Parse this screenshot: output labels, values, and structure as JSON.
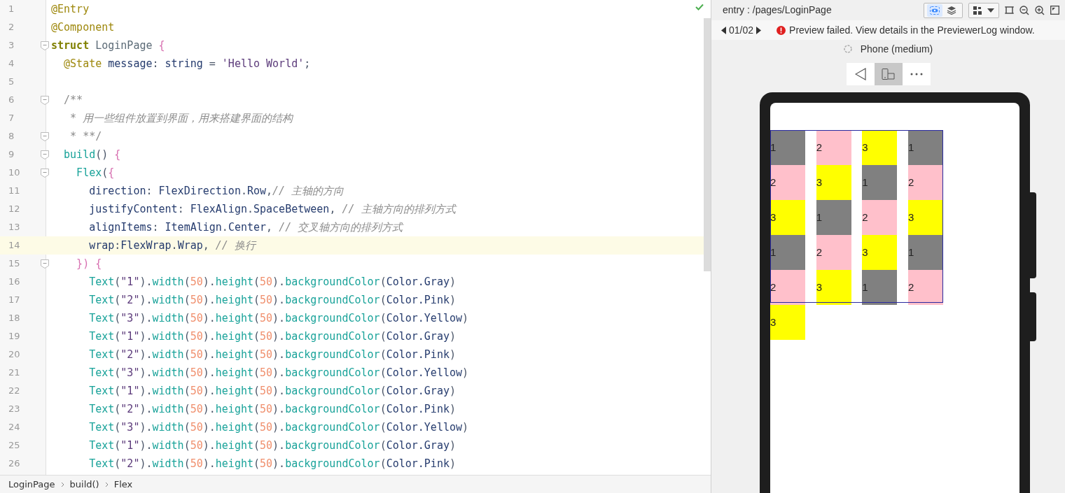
{
  "editor": {
    "lines": [
      {
        "number": "1",
        "fold": false,
        "current": false,
        "tokens": [
          {
            "kind": "ann",
            "text": "@Entry"
          }
        ]
      },
      {
        "number": "2",
        "fold": false,
        "current": false,
        "tokens": [
          {
            "kind": "ann",
            "text": "@Component"
          }
        ]
      },
      {
        "number": "3",
        "fold": true,
        "current": false,
        "tokens": [
          {
            "kind": "kw",
            "text": "struct "
          },
          {
            "kind": "cls",
            "text": "LoginPage "
          },
          {
            "kind": "br",
            "text": "{"
          }
        ]
      },
      {
        "number": "4",
        "fold": false,
        "current": false,
        "tokens": [
          {
            "kind": "ann",
            "text": "  @State "
          },
          {
            "kind": "id",
            "text": "message"
          },
          {
            "kind": "p",
            "text": ": "
          },
          {
            "kind": "id",
            "text": "string "
          },
          {
            "kind": "p",
            "text": "= "
          },
          {
            "kind": "s",
            "text": "'Hello World'"
          },
          {
            "kind": "p",
            "text": ";"
          }
        ]
      },
      {
        "number": "5",
        "fold": false,
        "current": false
      },
      {
        "number": "6",
        "fold": true,
        "current": false,
        "tokens": [
          {
            "kind": "doc",
            "text": "  /**"
          }
        ]
      },
      {
        "number": "7",
        "fold": false,
        "current": false,
        "tokens": [
          {
            "kind": "doc",
            "text": "   * "
          },
          {
            "kind": "cmt",
            "text": "用一些组件放置到界面，用来搭建界面的结构"
          }
        ]
      },
      {
        "number": "8",
        "fold": true,
        "current": false,
        "tokens": [
          {
            "kind": "doc",
            "text": "   * **/"
          }
        ]
      },
      {
        "number": "9",
        "fold": true,
        "current": false,
        "tokens": [
          {
            "kind": "fn",
            "text": "  build"
          },
          {
            "kind": "p",
            "text": "() "
          },
          {
            "kind": "br",
            "text": "{"
          }
        ]
      },
      {
        "number": "10",
        "fold": true,
        "current": false,
        "tokens": [
          {
            "kind": "fn",
            "text": "    Flex"
          },
          {
            "kind": "p",
            "text": "("
          },
          {
            "kind": "br",
            "text": "{"
          }
        ]
      },
      {
        "number": "11",
        "fold": false,
        "current": false,
        "tokens": [
          {
            "kind": "id",
            "text": "      direction"
          },
          {
            "kind": "p",
            "text": ": "
          },
          {
            "kind": "id",
            "text": "FlexDirection"
          },
          {
            "kind": "p",
            "text": "."
          },
          {
            "kind": "id",
            "text": "Row"
          },
          {
            "kind": "p",
            "text": ","
          },
          {
            "kind": "cmt",
            "text": "// 主轴的方向"
          }
        ]
      },
      {
        "number": "12",
        "fold": false,
        "current": false,
        "tokens": [
          {
            "kind": "id",
            "text": "      justifyContent"
          },
          {
            "kind": "p",
            "text": ": "
          },
          {
            "kind": "id",
            "text": "FlexAlign"
          },
          {
            "kind": "p",
            "text": "."
          },
          {
            "kind": "id",
            "text": "SpaceBetween"
          },
          {
            "kind": "p",
            "text": ", "
          },
          {
            "kind": "cmt",
            "text": "// 主轴方向的排列方式"
          }
        ]
      },
      {
        "number": "13",
        "fold": false,
        "current": false,
        "tokens": [
          {
            "kind": "id",
            "text": "      alignItems"
          },
          {
            "kind": "p",
            "text": ": "
          },
          {
            "kind": "id",
            "text": "ItemAlign"
          },
          {
            "kind": "p",
            "text": "."
          },
          {
            "kind": "id",
            "text": "Center"
          },
          {
            "kind": "p",
            "text": ", "
          },
          {
            "kind": "cmt",
            "text": "// 交叉轴方向的排列方式"
          }
        ]
      },
      {
        "number": "14",
        "fold": false,
        "current": true,
        "tokens": [
          {
            "kind": "id",
            "text": "      wrap"
          },
          {
            "kind": "p",
            "text": ":"
          },
          {
            "kind": "id",
            "text": "FlexWrap"
          },
          {
            "kind": "p",
            "text": "."
          },
          {
            "kind": "id",
            "text": "Wrap"
          },
          {
            "kind": "p",
            "text": ", "
          },
          {
            "kind": "cmt",
            "text": "// 换行"
          }
        ]
      },
      {
        "number": "15",
        "fold": true,
        "current": false,
        "tokens": [
          {
            "kind": "br",
            "text": "    }) {"
          }
        ]
      },
      {
        "number": "16",
        "fold": false,
        "current": false,
        "tokens": [
          {
            "kind": "fn",
            "text": "      Text"
          },
          {
            "kind": "p",
            "text": "("
          },
          {
            "kind": "s",
            "text": "\"1\""
          },
          {
            "kind": "p",
            "text": ")."
          },
          {
            "kind": "fn",
            "text": "width"
          },
          {
            "kind": "p",
            "text": "("
          },
          {
            "kind": "n",
            "text": "50"
          },
          {
            "kind": "p",
            "text": ")."
          },
          {
            "kind": "fn",
            "text": "height"
          },
          {
            "kind": "p",
            "text": "("
          },
          {
            "kind": "n",
            "text": "50"
          },
          {
            "kind": "p",
            "text": ")."
          },
          {
            "kind": "fn",
            "text": "backgroundColor"
          },
          {
            "kind": "p",
            "text": "("
          },
          {
            "kind": "id",
            "text": "Color.Gray"
          },
          {
            "kind": "p",
            "text": ")"
          }
        ]
      },
      {
        "number": "17",
        "fold": false,
        "current": false,
        "tokens": [
          {
            "kind": "fn",
            "text": "      Text"
          },
          {
            "kind": "p",
            "text": "("
          },
          {
            "kind": "s",
            "text": "\"2\""
          },
          {
            "kind": "p",
            "text": ")."
          },
          {
            "kind": "fn",
            "text": "width"
          },
          {
            "kind": "p",
            "text": "("
          },
          {
            "kind": "n",
            "text": "50"
          },
          {
            "kind": "p",
            "text": ")."
          },
          {
            "kind": "fn",
            "text": "height"
          },
          {
            "kind": "p",
            "text": "("
          },
          {
            "kind": "n",
            "text": "50"
          },
          {
            "kind": "p",
            "text": ")."
          },
          {
            "kind": "fn",
            "text": "backgroundColor"
          },
          {
            "kind": "p",
            "text": "("
          },
          {
            "kind": "id",
            "text": "Color.Pink"
          },
          {
            "kind": "p",
            "text": ")"
          }
        ]
      },
      {
        "number": "18",
        "fold": false,
        "current": false,
        "tokens": [
          {
            "kind": "fn",
            "text": "      Text"
          },
          {
            "kind": "p",
            "text": "("
          },
          {
            "kind": "s",
            "text": "\"3\""
          },
          {
            "kind": "p",
            "text": ")."
          },
          {
            "kind": "fn",
            "text": "width"
          },
          {
            "kind": "p",
            "text": "("
          },
          {
            "kind": "n",
            "text": "50"
          },
          {
            "kind": "p",
            "text": ")."
          },
          {
            "kind": "fn",
            "text": "height"
          },
          {
            "kind": "p",
            "text": "("
          },
          {
            "kind": "n",
            "text": "50"
          },
          {
            "kind": "p",
            "text": ")."
          },
          {
            "kind": "fn",
            "text": "backgroundColor"
          },
          {
            "kind": "p",
            "text": "("
          },
          {
            "kind": "id",
            "text": "Color.Yellow"
          },
          {
            "kind": "p",
            "text": ")"
          }
        ]
      },
      {
        "number": "19",
        "fold": false,
        "current": false,
        "tokens": [
          {
            "kind": "fn",
            "text": "      Text"
          },
          {
            "kind": "p",
            "text": "("
          },
          {
            "kind": "s",
            "text": "\"1\""
          },
          {
            "kind": "p",
            "text": ")."
          },
          {
            "kind": "fn",
            "text": "width"
          },
          {
            "kind": "p",
            "text": "("
          },
          {
            "kind": "n",
            "text": "50"
          },
          {
            "kind": "p",
            "text": ")."
          },
          {
            "kind": "fn",
            "text": "height"
          },
          {
            "kind": "p",
            "text": "("
          },
          {
            "kind": "n",
            "text": "50"
          },
          {
            "kind": "p",
            "text": ")."
          },
          {
            "kind": "fn",
            "text": "backgroundColor"
          },
          {
            "kind": "p",
            "text": "("
          },
          {
            "kind": "id",
            "text": "Color.Gray"
          },
          {
            "kind": "p",
            "text": ")"
          }
        ]
      },
      {
        "number": "20",
        "fold": false,
        "current": false,
        "tokens": [
          {
            "kind": "fn",
            "text": "      Text"
          },
          {
            "kind": "p",
            "text": "("
          },
          {
            "kind": "s",
            "text": "\"2\""
          },
          {
            "kind": "p",
            "text": ")."
          },
          {
            "kind": "fn",
            "text": "width"
          },
          {
            "kind": "p",
            "text": "("
          },
          {
            "kind": "n",
            "text": "50"
          },
          {
            "kind": "p",
            "text": ")."
          },
          {
            "kind": "fn",
            "text": "height"
          },
          {
            "kind": "p",
            "text": "("
          },
          {
            "kind": "n",
            "text": "50"
          },
          {
            "kind": "p",
            "text": ")."
          },
          {
            "kind": "fn",
            "text": "backgroundColor"
          },
          {
            "kind": "p",
            "text": "("
          },
          {
            "kind": "id",
            "text": "Color.Pink"
          },
          {
            "kind": "p",
            "text": ")"
          }
        ]
      },
      {
        "number": "21",
        "fold": false,
        "current": false,
        "tokens": [
          {
            "kind": "fn",
            "text": "      Text"
          },
          {
            "kind": "p",
            "text": "("
          },
          {
            "kind": "s",
            "text": "\"3\""
          },
          {
            "kind": "p",
            "text": ")."
          },
          {
            "kind": "fn",
            "text": "width"
          },
          {
            "kind": "p",
            "text": "("
          },
          {
            "kind": "n",
            "text": "50"
          },
          {
            "kind": "p",
            "text": ")."
          },
          {
            "kind": "fn",
            "text": "height"
          },
          {
            "kind": "p",
            "text": "("
          },
          {
            "kind": "n",
            "text": "50"
          },
          {
            "kind": "p",
            "text": ")."
          },
          {
            "kind": "fn",
            "text": "backgroundColor"
          },
          {
            "kind": "p",
            "text": "("
          },
          {
            "kind": "id",
            "text": "Color.Yellow"
          },
          {
            "kind": "p",
            "text": ")"
          }
        ]
      },
      {
        "number": "22",
        "fold": false,
        "current": false,
        "tokens": [
          {
            "kind": "fn",
            "text": "      Text"
          },
          {
            "kind": "p",
            "text": "("
          },
          {
            "kind": "s",
            "text": "\"1\""
          },
          {
            "kind": "p",
            "text": ")."
          },
          {
            "kind": "fn",
            "text": "width"
          },
          {
            "kind": "p",
            "text": "("
          },
          {
            "kind": "n",
            "text": "50"
          },
          {
            "kind": "p",
            "text": ")."
          },
          {
            "kind": "fn",
            "text": "height"
          },
          {
            "kind": "p",
            "text": "("
          },
          {
            "kind": "n",
            "text": "50"
          },
          {
            "kind": "p",
            "text": ")."
          },
          {
            "kind": "fn",
            "text": "backgroundColor"
          },
          {
            "kind": "p",
            "text": "("
          },
          {
            "kind": "id",
            "text": "Color.Gray"
          },
          {
            "kind": "p",
            "text": ")"
          }
        ]
      },
      {
        "number": "23",
        "fold": false,
        "current": false,
        "tokens": [
          {
            "kind": "fn",
            "text": "      Text"
          },
          {
            "kind": "p",
            "text": "("
          },
          {
            "kind": "s",
            "text": "\"2\""
          },
          {
            "kind": "p",
            "text": ")."
          },
          {
            "kind": "fn",
            "text": "width"
          },
          {
            "kind": "p",
            "text": "("
          },
          {
            "kind": "n",
            "text": "50"
          },
          {
            "kind": "p",
            "text": ")."
          },
          {
            "kind": "fn",
            "text": "height"
          },
          {
            "kind": "p",
            "text": "("
          },
          {
            "kind": "n",
            "text": "50"
          },
          {
            "kind": "p",
            "text": ")."
          },
          {
            "kind": "fn",
            "text": "backgroundColor"
          },
          {
            "kind": "p",
            "text": "("
          },
          {
            "kind": "id",
            "text": "Color.Pink"
          },
          {
            "kind": "p",
            "text": ")"
          }
        ]
      },
      {
        "number": "24",
        "fold": false,
        "current": false,
        "tokens": [
          {
            "kind": "fn",
            "text": "      Text"
          },
          {
            "kind": "p",
            "text": "("
          },
          {
            "kind": "s",
            "text": "\"3\""
          },
          {
            "kind": "p",
            "text": ")."
          },
          {
            "kind": "fn",
            "text": "width"
          },
          {
            "kind": "p",
            "text": "("
          },
          {
            "kind": "n",
            "text": "50"
          },
          {
            "kind": "p",
            "text": ")."
          },
          {
            "kind": "fn",
            "text": "height"
          },
          {
            "kind": "p",
            "text": "("
          },
          {
            "kind": "n",
            "text": "50"
          },
          {
            "kind": "p",
            "text": ")."
          },
          {
            "kind": "fn",
            "text": "backgroundColor"
          },
          {
            "kind": "p",
            "text": "("
          },
          {
            "kind": "id",
            "text": "Color.Yellow"
          },
          {
            "kind": "p",
            "text": ")"
          }
        ]
      },
      {
        "number": "25",
        "fold": false,
        "current": false,
        "tokens": [
          {
            "kind": "fn",
            "text": "      Text"
          },
          {
            "kind": "p",
            "text": "("
          },
          {
            "kind": "s",
            "text": "\"1\""
          },
          {
            "kind": "p",
            "text": ")."
          },
          {
            "kind": "fn",
            "text": "width"
          },
          {
            "kind": "p",
            "text": "("
          },
          {
            "kind": "n",
            "text": "50"
          },
          {
            "kind": "p",
            "text": ")."
          },
          {
            "kind": "fn",
            "text": "height"
          },
          {
            "kind": "p",
            "text": "("
          },
          {
            "kind": "n",
            "text": "50"
          },
          {
            "kind": "p",
            "text": ")."
          },
          {
            "kind": "fn",
            "text": "backgroundColor"
          },
          {
            "kind": "p",
            "text": "("
          },
          {
            "kind": "id",
            "text": "Color.Gray"
          },
          {
            "kind": "p",
            "text": ")"
          }
        ]
      },
      {
        "number": "26",
        "fold": false,
        "current": false,
        "tokens": [
          {
            "kind": "fn",
            "text": "      Text"
          },
          {
            "kind": "p",
            "text": "("
          },
          {
            "kind": "s",
            "text": "\"2\""
          },
          {
            "kind": "p",
            "text": ")."
          },
          {
            "kind": "fn",
            "text": "width"
          },
          {
            "kind": "p",
            "text": "("
          },
          {
            "kind": "n",
            "text": "50"
          },
          {
            "kind": "p",
            "text": ")."
          },
          {
            "kind": "fn",
            "text": "height"
          },
          {
            "kind": "p",
            "text": "("
          },
          {
            "kind": "n",
            "text": "50"
          },
          {
            "kind": "p",
            "text": ")."
          },
          {
            "kind": "fn",
            "text": "backgroundColor"
          },
          {
            "kind": "p",
            "text": "("
          },
          {
            "kind": "id",
            "text": "Color.Pink"
          },
          {
            "kind": "p",
            "text": ")"
          }
        ]
      }
    ]
  },
  "breadcrumb": [
    "LoginPage",
    "build()",
    "Flex"
  ],
  "previewer": {
    "path": "entry : /pages/LoginPage",
    "tools": [
      {
        "kind": "inspect",
        "selected": true
      },
      {
        "kind": "layers",
        "selected": false
      }
    ],
    "page_counter": "01/02",
    "error": "Preview failed. View details in the PreviewerLog window.",
    "device": "Phone (medium)",
    "device_tools": [
      {
        "kind": "back",
        "selected": false
      },
      {
        "kind": "fold",
        "selected": true
      },
      {
        "kind": "more",
        "selected": false
      }
    ],
    "cells": [
      {
        "label": "1",
        "color": "#808080"
      },
      {
        "label": "2",
        "color": "#ffc0cb"
      },
      {
        "label": "3",
        "color": "#ffff00"
      },
      {
        "label": "1",
        "color": "#808080"
      },
      {
        "label": "2",
        "color": "#ffc0cb"
      },
      {
        "label": "3",
        "color": "#ffff00"
      },
      {
        "label": "1",
        "color": "#808080"
      },
      {
        "label": "2",
        "color": "#ffc0cb"
      },
      {
        "label": "3",
        "color": "#ffff00"
      },
      {
        "label": "1",
        "color": "#808080"
      },
      {
        "label": "2",
        "color": "#ffc0cb"
      },
      {
        "label": "3",
        "color": "#ffff00"
      },
      {
        "label": "1",
        "color": "#808080"
      },
      {
        "label": "2",
        "color": "#ffc0cb"
      },
      {
        "label": "3",
        "color": "#ffff00"
      },
      {
        "label": "1",
        "color": "#808080"
      },
      {
        "label": "2",
        "color": "#ffc0cb"
      },
      {
        "label": "3",
        "color": "#ffff00"
      },
      {
        "label": "1",
        "color": "#808080"
      },
      {
        "label": "2",
        "color": "#ffc0cb"
      },
      {
        "label": "3",
        "color": "#ffff00"
      }
    ]
  }
}
